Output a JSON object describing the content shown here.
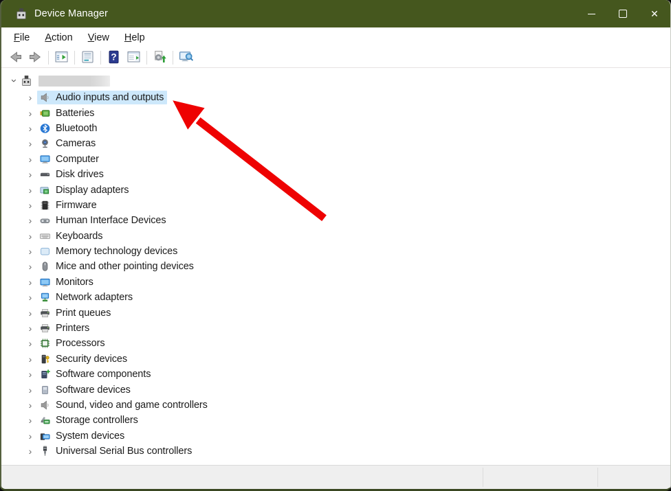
{
  "window": {
    "title": "Device Manager",
    "titlebar_color": "#45571e"
  },
  "menubar": {
    "items": [
      {
        "label": "File"
      },
      {
        "label": "Action"
      },
      {
        "label": "View"
      },
      {
        "label": "Help"
      }
    ]
  },
  "toolbar": {
    "buttons": [
      {
        "name": "back",
        "icon": "back-arrow"
      },
      {
        "name": "forward",
        "icon": "forward-arrow"
      },
      {
        "name": "separator"
      },
      {
        "name": "show-console-tree",
        "icon": "console-tree"
      },
      {
        "name": "separator"
      },
      {
        "name": "properties",
        "icon": "properties"
      },
      {
        "name": "separator"
      },
      {
        "name": "help",
        "icon": "help"
      },
      {
        "name": "show-action-pane",
        "icon": "action-pane"
      },
      {
        "name": "separator"
      },
      {
        "name": "scan-for-hardware-changes",
        "icon": "scan"
      },
      {
        "name": "separator"
      },
      {
        "name": "remote-computer",
        "icon": "remote"
      }
    ]
  },
  "tree": {
    "root": {
      "label_redacted": true,
      "icon": "device-manager",
      "expanded": true
    },
    "items": [
      {
        "label": "Audio inputs and outputs",
        "icon": "audio",
        "selected": true
      },
      {
        "label": "Batteries",
        "icon": "battery"
      },
      {
        "label": "Bluetooth",
        "icon": "bluetooth"
      },
      {
        "label": "Cameras",
        "icon": "camera"
      },
      {
        "label": "Computer",
        "icon": "computer"
      },
      {
        "label": "Disk drives",
        "icon": "disk"
      },
      {
        "label": "Display adapters",
        "icon": "display"
      },
      {
        "label": "Firmware",
        "icon": "firmware"
      },
      {
        "label": "Human Interface Devices",
        "icon": "hid"
      },
      {
        "label": "Keyboards",
        "icon": "keyboard"
      },
      {
        "label": "Memory technology devices",
        "icon": "memory"
      },
      {
        "label": "Mice and other pointing devices",
        "icon": "mouse"
      },
      {
        "label": "Monitors",
        "icon": "monitor"
      },
      {
        "label": "Network adapters",
        "icon": "network"
      },
      {
        "label": "Print queues",
        "icon": "printqueue"
      },
      {
        "label": "Printers",
        "icon": "printer"
      },
      {
        "label": "Processors",
        "icon": "processor"
      },
      {
        "label": "Security devices",
        "icon": "security"
      },
      {
        "label": "Software components",
        "icon": "swcomponent"
      },
      {
        "label": "Software devices",
        "icon": "swdevice"
      },
      {
        "label": "Sound, video and game controllers",
        "icon": "sound"
      },
      {
        "label": "Storage controllers",
        "icon": "storage"
      },
      {
        "label": "System devices",
        "icon": "system"
      },
      {
        "label": "Universal Serial Bus controllers",
        "icon": "usb"
      }
    ]
  },
  "annotation": {
    "type": "arrow",
    "color": "#ee0202",
    "points_to": "Audio inputs and outputs"
  },
  "colors": {
    "selection": "#cde8fb",
    "statusbar": "#efefef"
  }
}
